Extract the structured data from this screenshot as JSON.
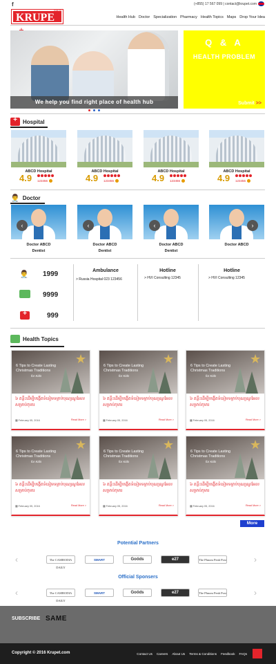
{
  "topbar": {
    "fb": "f",
    "contact": "(+855) 17 567 099 | contact@krupet.com"
  },
  "logo": {
    "text": "KRUPE",
    "small": "គ្រូពេទ្យ"
  },
  "nav": [
    "Health Hub",
    "Doctor",
    "Specialization",
    "Pharmacy",
    "Health Topics",
    "Maps",
    "Drop Your Idea"
  ],
  "slider": {
    "caption": "We help you find right place of health hub"
  },
  "qa": {
    "title": "Q & A",
    "subtitle": "HEALTH PROBLEM",
    "submit": "Submit",
    "submit_arrow": ">>"
  },
  "hospital": {
    "title": "Hospital",
    "items": [
      {
        "name": "ABCD Hospital",
        "rating": "4.9",
        "count": "123456"
      },
      {
        "name": "ABCD Hospital",
        "rating": "4.9",
        "count": "123456"
      },
      {
        "name": "ABCD Hospital",
        "rating": "4.9",
        "count": "123456"
      },
      {
        "name": "ABCD Hospital",
        "rating": "4.9",
        "count": "123456"
      }
    ]
  },
  "doctor": {
    "title": "Doctor",
    "items": [
      {
        "name": "Doctor ABCD",
        "role": "Dentist"
      },
      {
        "name": "Doctor ABCD",
        "role": "Dentist"
      },
      {
        "name": "Doctor ABCD",
        "role": "Dentist"
      },
      {
        "name": "Doctor ABCD",
        "role": ""
      }
    ],
    "prev": "‹",
    "next": "›"
  },
  "stats": [
    "1999",
    "9999",
    "999"
  ],
  "info": [
    {
      "head": "Ambulance",
      "text": "> Russia Hospital 023 123456"
    },
    {
      "head": "Hotline",
      "text": "> HVI Consulting 12345"
    },
    {
      "head": "Hotline",
      "text": "> HVI Consulting 12345"
    }
  ],
  "topics": {
    "title": "Health Topics",
    "item": {
      "image_title": "6 Tips to Create Lasting Christmas Traditions",
      "image_sub": "for Kids",
      "kh": "៦ គន្លឹះដើម្បីបង្កើតទំនៀមទម្លាប់បុណ្យណូអែលសម្រាប់កុមារ",
      "date": "February 05, 2016",
      "read_more": "Read More >"
    },
    "more": "More"
  },
  "partners": {
    "title": "Potential Partners",
    "sponsors_title": "Official Sponsers",
    "logos": [
      "The CAMBODIA DAILY",
      "SMART",
      "Goöds",
      "e27",
      "The Phnom Penh Post"
    ]
  },
  "subscribe": {
    "label": "SUBSCRIBE",
    "value": "SAME"
  },
  "footer": {
    "copyright": "Copyright © 2016 Krupet.com",
    "links": [
      "Contact Us",
      "Careers",
      "About Us",
      "Terms & Conditions",
      "Feedbook",
      "FAQs"
    ]
  },
  "colors": {
    "brand": "#e3242b",
    "accent": "#ffff00",
    "link": "#2a6fc8"
  }
}
